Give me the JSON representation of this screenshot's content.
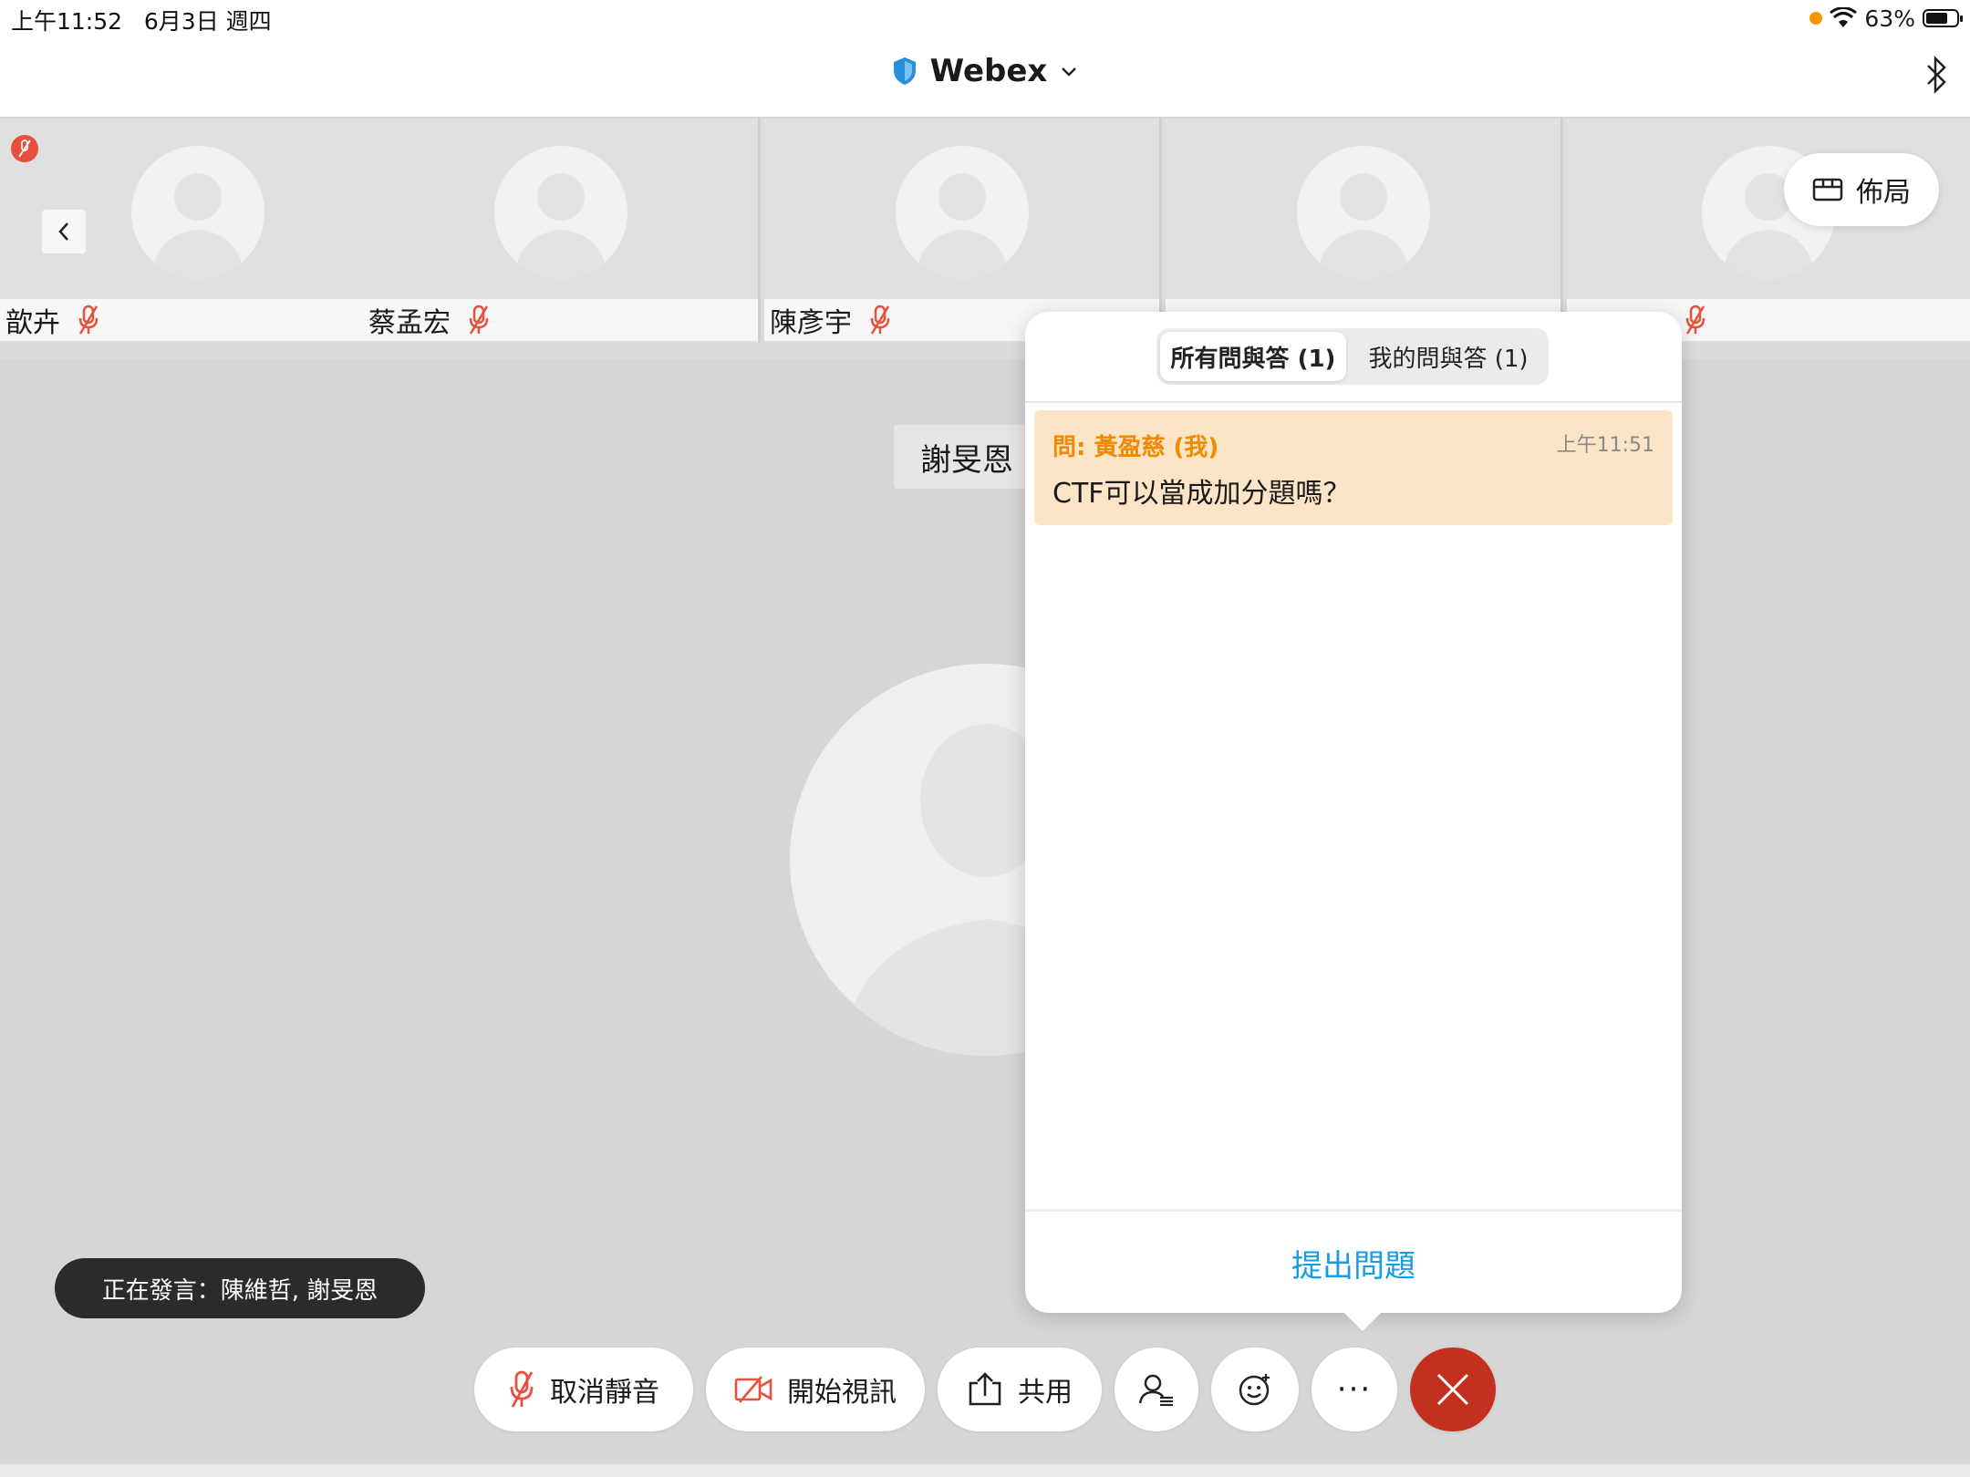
{
  "status_bar": {
    "time": "上午11:52",
    "date": "6月3日 週四",
    "battery": "63%"
  },
  "header": {
    "title": "Webex"
  },
  "strip": {
    "tiles": [
      {
        "name": "歆卉"
      },
      {
        "name": "蔡孟宏"
      },
      {
        "name": "陳彥宇"
      },
      {
        "name": ""
      },
      {
        "name": ""
      }
    ],
    "layout_button": "佈局"
  },
  "stage": {
    "speaker_name": "謝旻恩",
    "speaking_now": "正在發言：陳維哲, 謝旻恩"
  },
  "qa": {
    "tabs": [
      {
        "label": "所有問與答 (1)",
        "active": true
      },
      {
        "label": "我的問與答 (1)",
        "active": false
      }
    ],
    "questions": [
      {
        "asker": "問: 黃盈慈 (我)",
        "time": "上午11:51",
        "text": "CTF可以當成加分題嗎？"
      }
    ],
    "ask_button": "提出問題"
  },
  "toolbar": {
    "unmute": "取消靜音",
    "start_video": "開始視訊",
    "share": "共用",
    "more": "···"
  },
  "colors": {
    "mute_red": "#e8503d",
    "end_call": "#c4301f",
    "question_bg": "#fce4c6",
    "question_asker": "#f08a00",
    "link_blue": "#1a9ce0"
  }
}
